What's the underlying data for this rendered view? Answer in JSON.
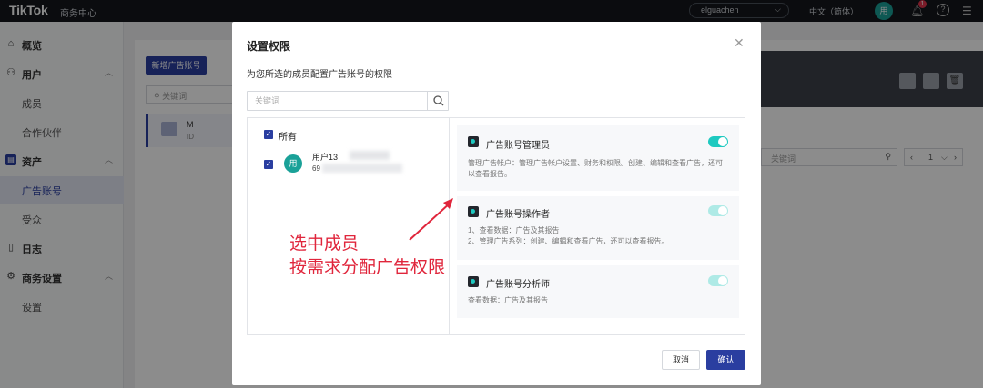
{
  "topbar": {
    "brand": "TikTok",
    "brand_sub": "商务中心",
    "account": "elguachen",
    "language": "中文（简体）",
    "avatar": "用",
    "notification_count": "1",
    "help": "?"
  },
  "sidebar": {
    "items": [
      {
        "label": "概览",
        "icon": "home-icon"
      },
      {
        "label": "用户",
        "icon": "user-icon"
      },
      {
        "label": "成员"
      },
      {
        "label": "合作伙伴"
      },
      {
        "label": "资产",
        "icon": "asset-icon"
      },
      {
        "label": "广告账号"
      },
      {
        "label": "受众"
      },
      {
        "label": "日志",
        "icon": "log-icon"
      },
      {
        "label": "商务设置",
        "icon": "settings-icon"
      },
      {
        "label": "设置"
      }
    ]
  },
  "background": {
    "new_button": "新增广告账号",
    "search_placeholder": "关键词",
    "row_text_1": "M",
    "row_text_2": "ID",
    "right_search_placeholder": "关键词",
    "pager_value": "1"
  },
  "modal": {
    "title": "设置权限",
    "subtitle": "为您所选的成员配置广告账号的权限",
    "search_placeholder": "关键词",
    "all_label": "所有",
    "member": {
      "avatar": "用",
      "name": "用户13",
      "id": "69"
    },
    "roles": [
      {
        "title": "广告账号管理员",
        "desc": [
          "管理广告帐户：管理广告帐户设置、财务和权限。创建、编辑和查看广告，还可以查看报告。"
        ],
        "enabled": true
      },
      {
        "title": "广告账号操作者",
        "desc": [
          "1、查看数据：广告及其报告",
          "2、管理广告系列：创建、编辑和查看广告，还可以查看报告。"
        ],
        "enabled": true
      },
      {
        "title": "广告账号分析师",
        "desc": [
          "查看数据：广告及其报告"
        ],
        "enabled": true
      }
    ],
    "cancel": "取消",
    "confirm": "确认"
  },
  "annotation": {
    "line1": "选中成员",
    "line2": "按需求分配广告权限",
    "color": "#e0263c"
  },
  "colors": {
    "primary": "#2a3ea0",
    "toggle_on": "#1ec9c0",
    "avatar": "#1aa198"
  }
}
